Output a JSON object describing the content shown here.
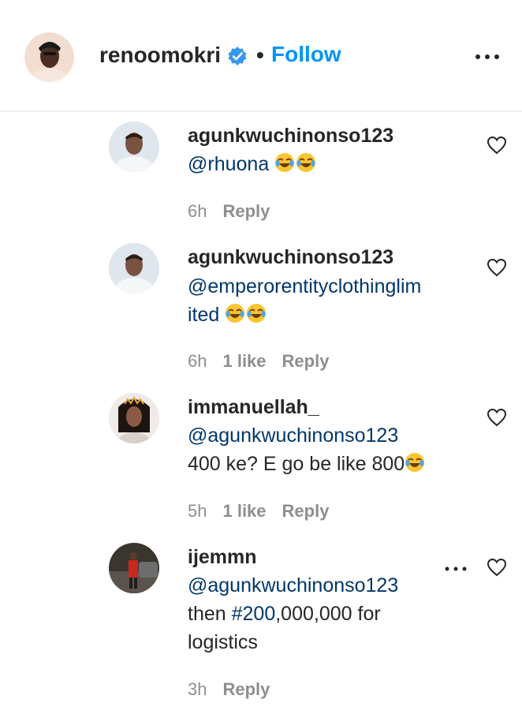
{
  "header": {
    "username": "renoomokri",
    "separator": "•",
    "follow_label": "Follow",
    "verified_icon": "verified-badge-icon",
    "more_icon": "more-horizontal-icon"
  },
  "comments": [
    {
      "username": "agunkwuchinonso123",
      "mention": "@rhuona",
      "text_line2": "",
      "text_extra": "",
      "emojis": 2,
      "time": "6h",
      "likes": "",
      "reply_label": "Reply"
    },
    {
      "username": "agunkwuchinonso123",
      "mention_line1": "@emperorentityclothinglim",
      "mention_line2": "ited",
      "emojis": 2,
      "time": "6h",
      "likes": "1 like",
      "reply_label": "Reply"
    },
    {
      "username": "immanuellah_",
      "mention": "@agunkwuchinonso123",
      "text_line2": "400 ke? E go be like 800",
      "emojis": 1,
      "time": "5h",
      "likes": "1 like",
      "reply_label": "Reply"
    },
    {
      "username": "ijemmn",
      "mention": "@agunkwuchinonso123",
      "text_pre": "then ",
      "hashtag": "#200",
      "text_post": ",000,000 for",
      "text_line4": "logistics",
      "time": "3h",
      "likes": "",
      "reply_label": "Reply"
    }
  ],
  "colors": {
    "link_blue": "#0095f6",
    "mention_blue": "#00376b",
    "meta_gray": "#8e8e8e",
    "text": "#262626"
  }
}
